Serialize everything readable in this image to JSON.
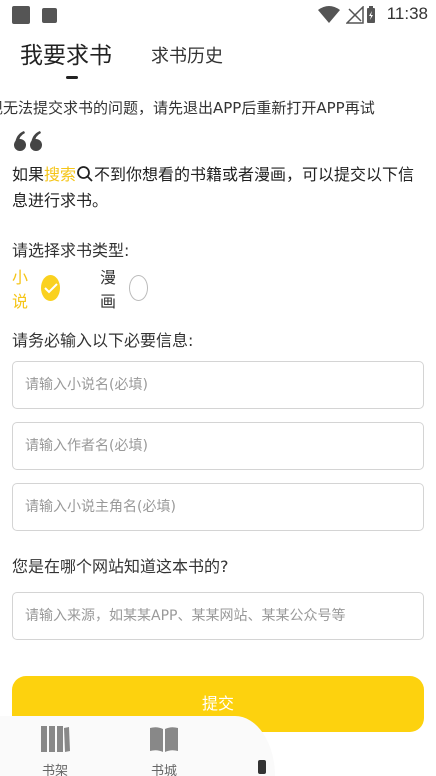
{
  "status_bar": {
    "time": "11:38",
    "icons": [
      "notification-square-icon",
      "notification-square-icon",
      "wifi-icon",
      "no-signal-icon",
      "battery-charging-icon"
    ]
  },
  "tabs": [
    {
      "label": "我要求书",
      "active": true
    },
    {
      "label": "求书历史",
      "active": false
    }
  ],
  "notice": "现无法提交求书的问题，请先退出APP后重新打开APP再试",
  "intro": {
    "prefix": "如果",
    "keyword": "搜索",
    "suffix": "不到你想看的书籍或者漫画，可以提交以下信息进行求书。"
  },
  "type_section": {
    "label": "请选择求书类型:",
    "options": [
      {
        "label": "小说",
        "selected": true
      },
      {
        "label": "漫画",
        "selected": false
      }
    ]
  },
  "required_section": {
    "label": "请务必输入以下必要信息:"
  },
  "fields": {
    "novel_name_placeholder": "请输入小说名(必填)",
    "author_placeholder": "请输入作者名(必填)",
    "protagonist_placeholder": "请输入小说主角名(必填)",
    "source_placeholder": "请输入来源，如某某APP、某某网站、某某公众号等"
  },
  "source_section": {
    "label": "您是在哪个网站知道这本书的?"
  },
  "submit_label": "提交",
  "bottom_nav": [
    {
      "label": "书架",
      "icon": "bookshelf-icon"
    },
    {
      "label": "书城",
      "icon": "book-icon"
    }
  ],
  "colors": {
    "accent": "#fdd20e",
    "accent_text": "#f5c518"
  }
}
